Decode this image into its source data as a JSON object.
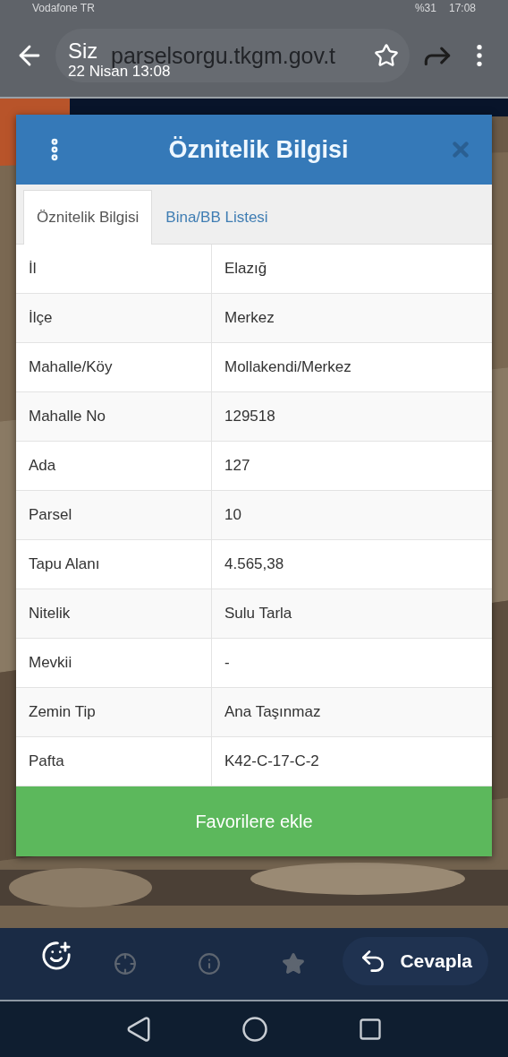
{
  "status_bar": {
    "carrier": "Vodafone TR",
    "battery": "%31",
    "time": "17:08"
  },
  "browser": {
    "url": "parselsorgu.tkgm.gov.t"
  },
  "viewer": {
    "sender": "Siz",
    "date": "22 Nisan 13:08",
    "reply_label": "Cevapla"
  },
  "dialog": {
    "title": "Öznitelik Bilgisi",
    "tabs": [
      {
        "label": "Öznitelik Bilgisi",
        "selected": true
      },
      {
        "label": "Bina/BB Listesi",
        "selected": false
      }
    ],
    "rows": [
      {
        "label": "İl",
        "value": "Elazığ"
      },
      {
        "label": "İlçe",
        "value": "Merkez"
      },
      {
        "label": "Mahalle/Köy",
        "value": "Mollakendi/Merkez"
      },
      {
        "label": "Mahalle No",
        "value": "129518"
      },
      {
        "label": "Ada",
        "value": "127"
      },
      {
        "label": "Parsel",
        "value": "10"
      },
      {
        "label": "Tapu Alanı",
        "value": "4.565,38"
      },
      {
        "label": "Nitelik",
        "value": "Sulu Tarla"
      },
      {
        "label": "Mevkii",
        "value": "-"
      },
      {
        "label": "Zemin Tip",
        "value": "Ana Taşınmaz"
      },
      {
        "label": "Pafta",
        "value": "K42-C-17-C-2"
      }
    ],
    "button": "Favorilere ekle"
  }
}
